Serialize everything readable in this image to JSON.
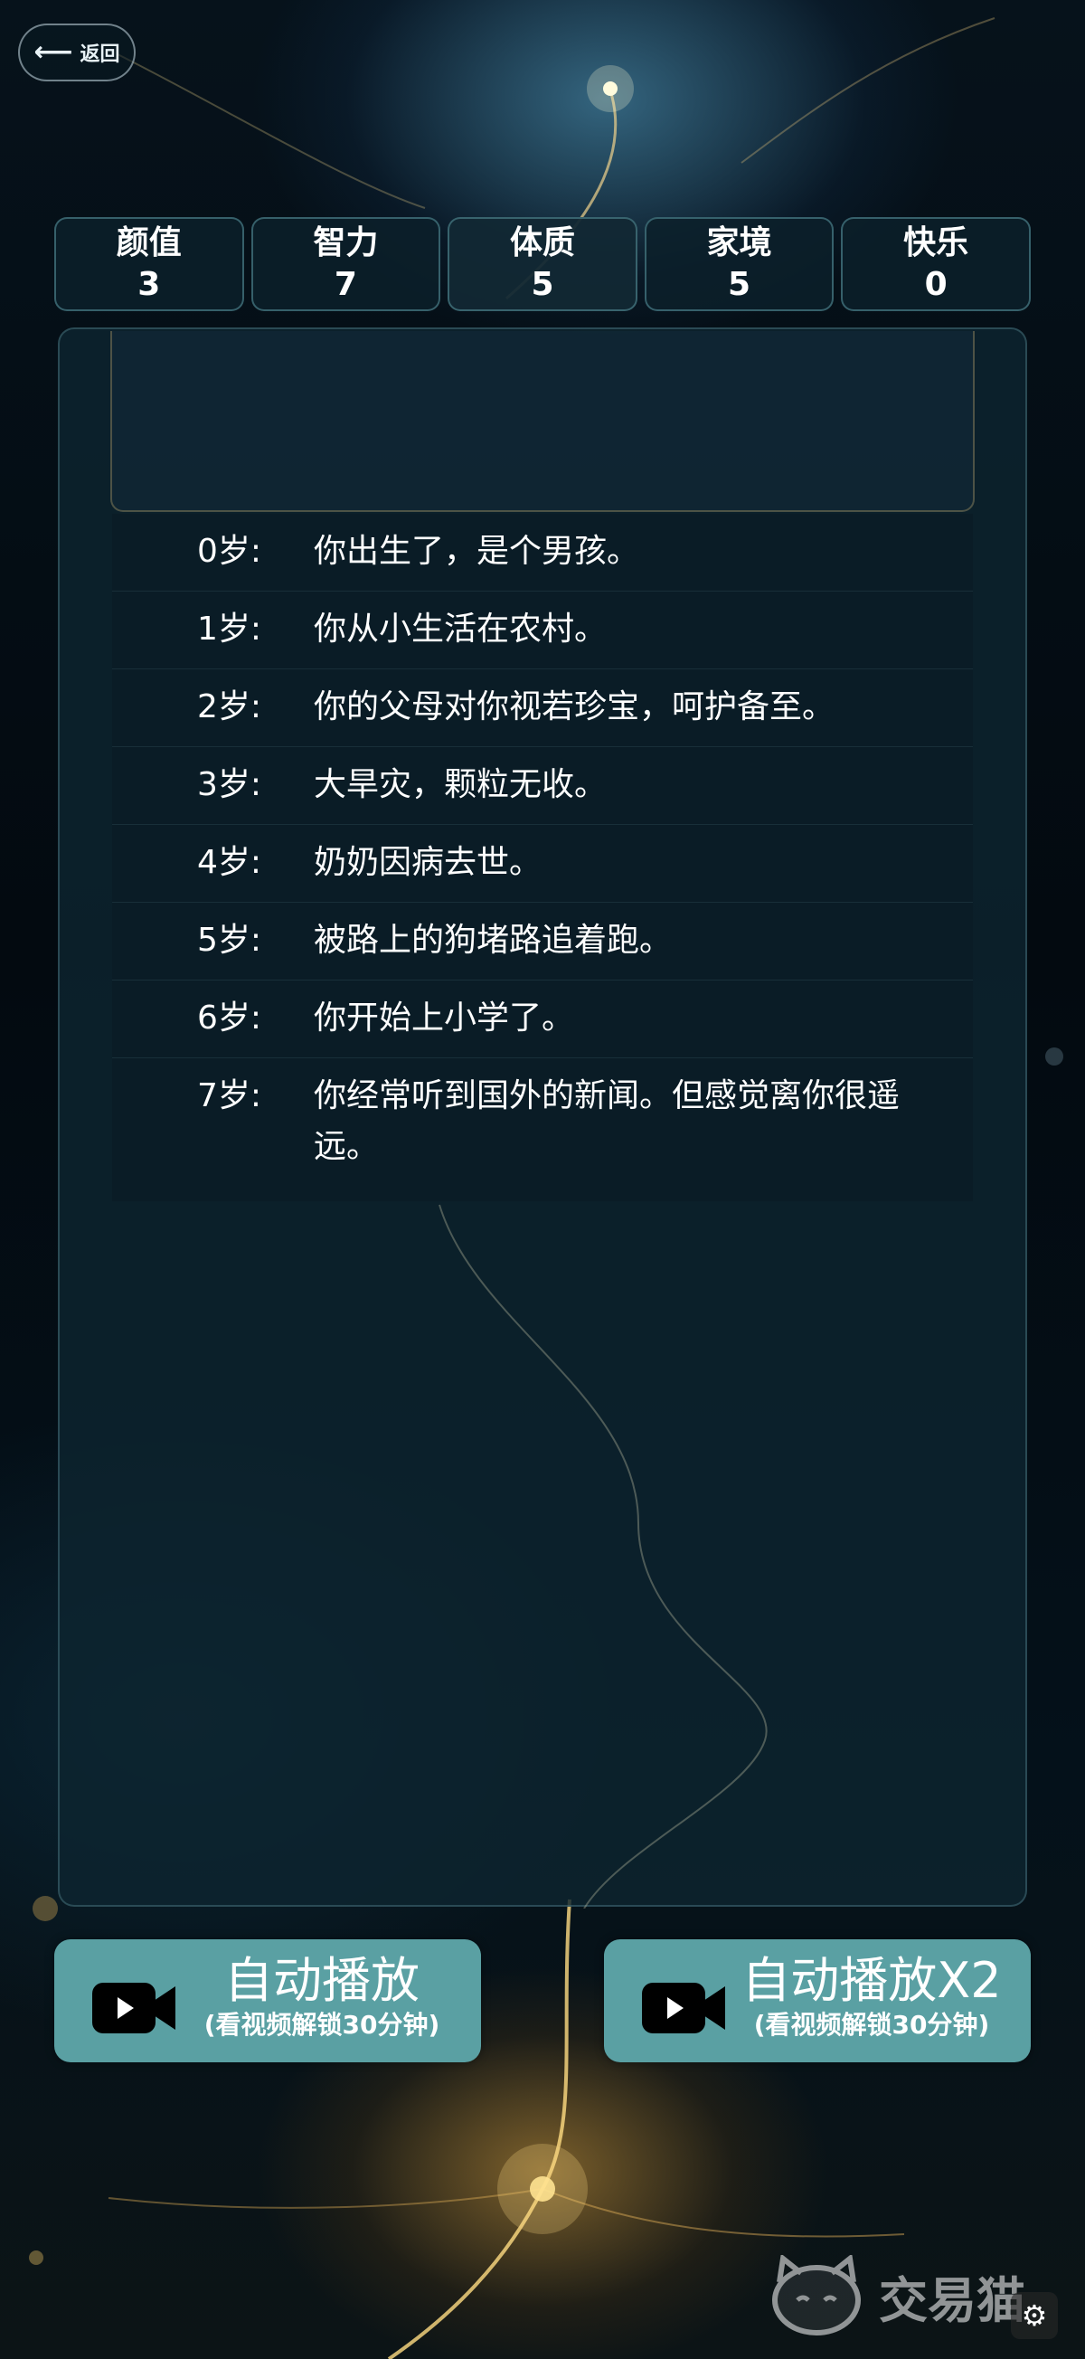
{
  "nav": {
    "back_label": "返回"
  },
  "stats": [
    {
      "name": "颜值",
      "value": "3"
    },
    {
      "name": "智力",
      "value": "7"
    },
    {
      "name": "体质",
      "value": "5"
    },
    {
      "name": "家境",
      "value": "5"
    },
    {
      "name": "快乐",
      "value": "0"
    }
  ],
  "events": [
    {
      "age": "0岁:",
      "text": "你出生了，是个男孩。"
    },
    {
      "age": "1岁:",
      "text": "你从小生活在农村。"
    },
    {
      "age": "2岁:",
      "text": "你的父母对你视若珍宝，呵护备至。"
    },
    {
      "age": "3岁:",
      "text": "大旱灾，颗粒无收。"
    },
    {
      "age": "4岁:",
      "text": "奶奶因病去世。"
    },
    {
      "age": "5岁:",
      "text": "被路上的狗堵路追着跑。"
    },
    {
      "age": "6岁:",
      "text": "你开始上小学了。"
    },
    {
      "age": "7岁:",
      "text": "你经常听到国外的新闻。但感觉离你很遥远。"
    }
  ],
  "actions": {
    "autoplay": {
      "title": "自动播放",
      "subtitle": "(看视频解锁30分钟)"
    },
    "autoplay_x2": {
      "title": "自动播放X2",
      "subtitle": "(看视频解锁30分钟)"
    }
  },
  "watermark": {
    "text": "交易猫"
  },
  "icons": [
    "back-arrow-icon",
    "video-camera-icon",
    "cat-logo-icon",
    "gear-icon"
  ]
}
